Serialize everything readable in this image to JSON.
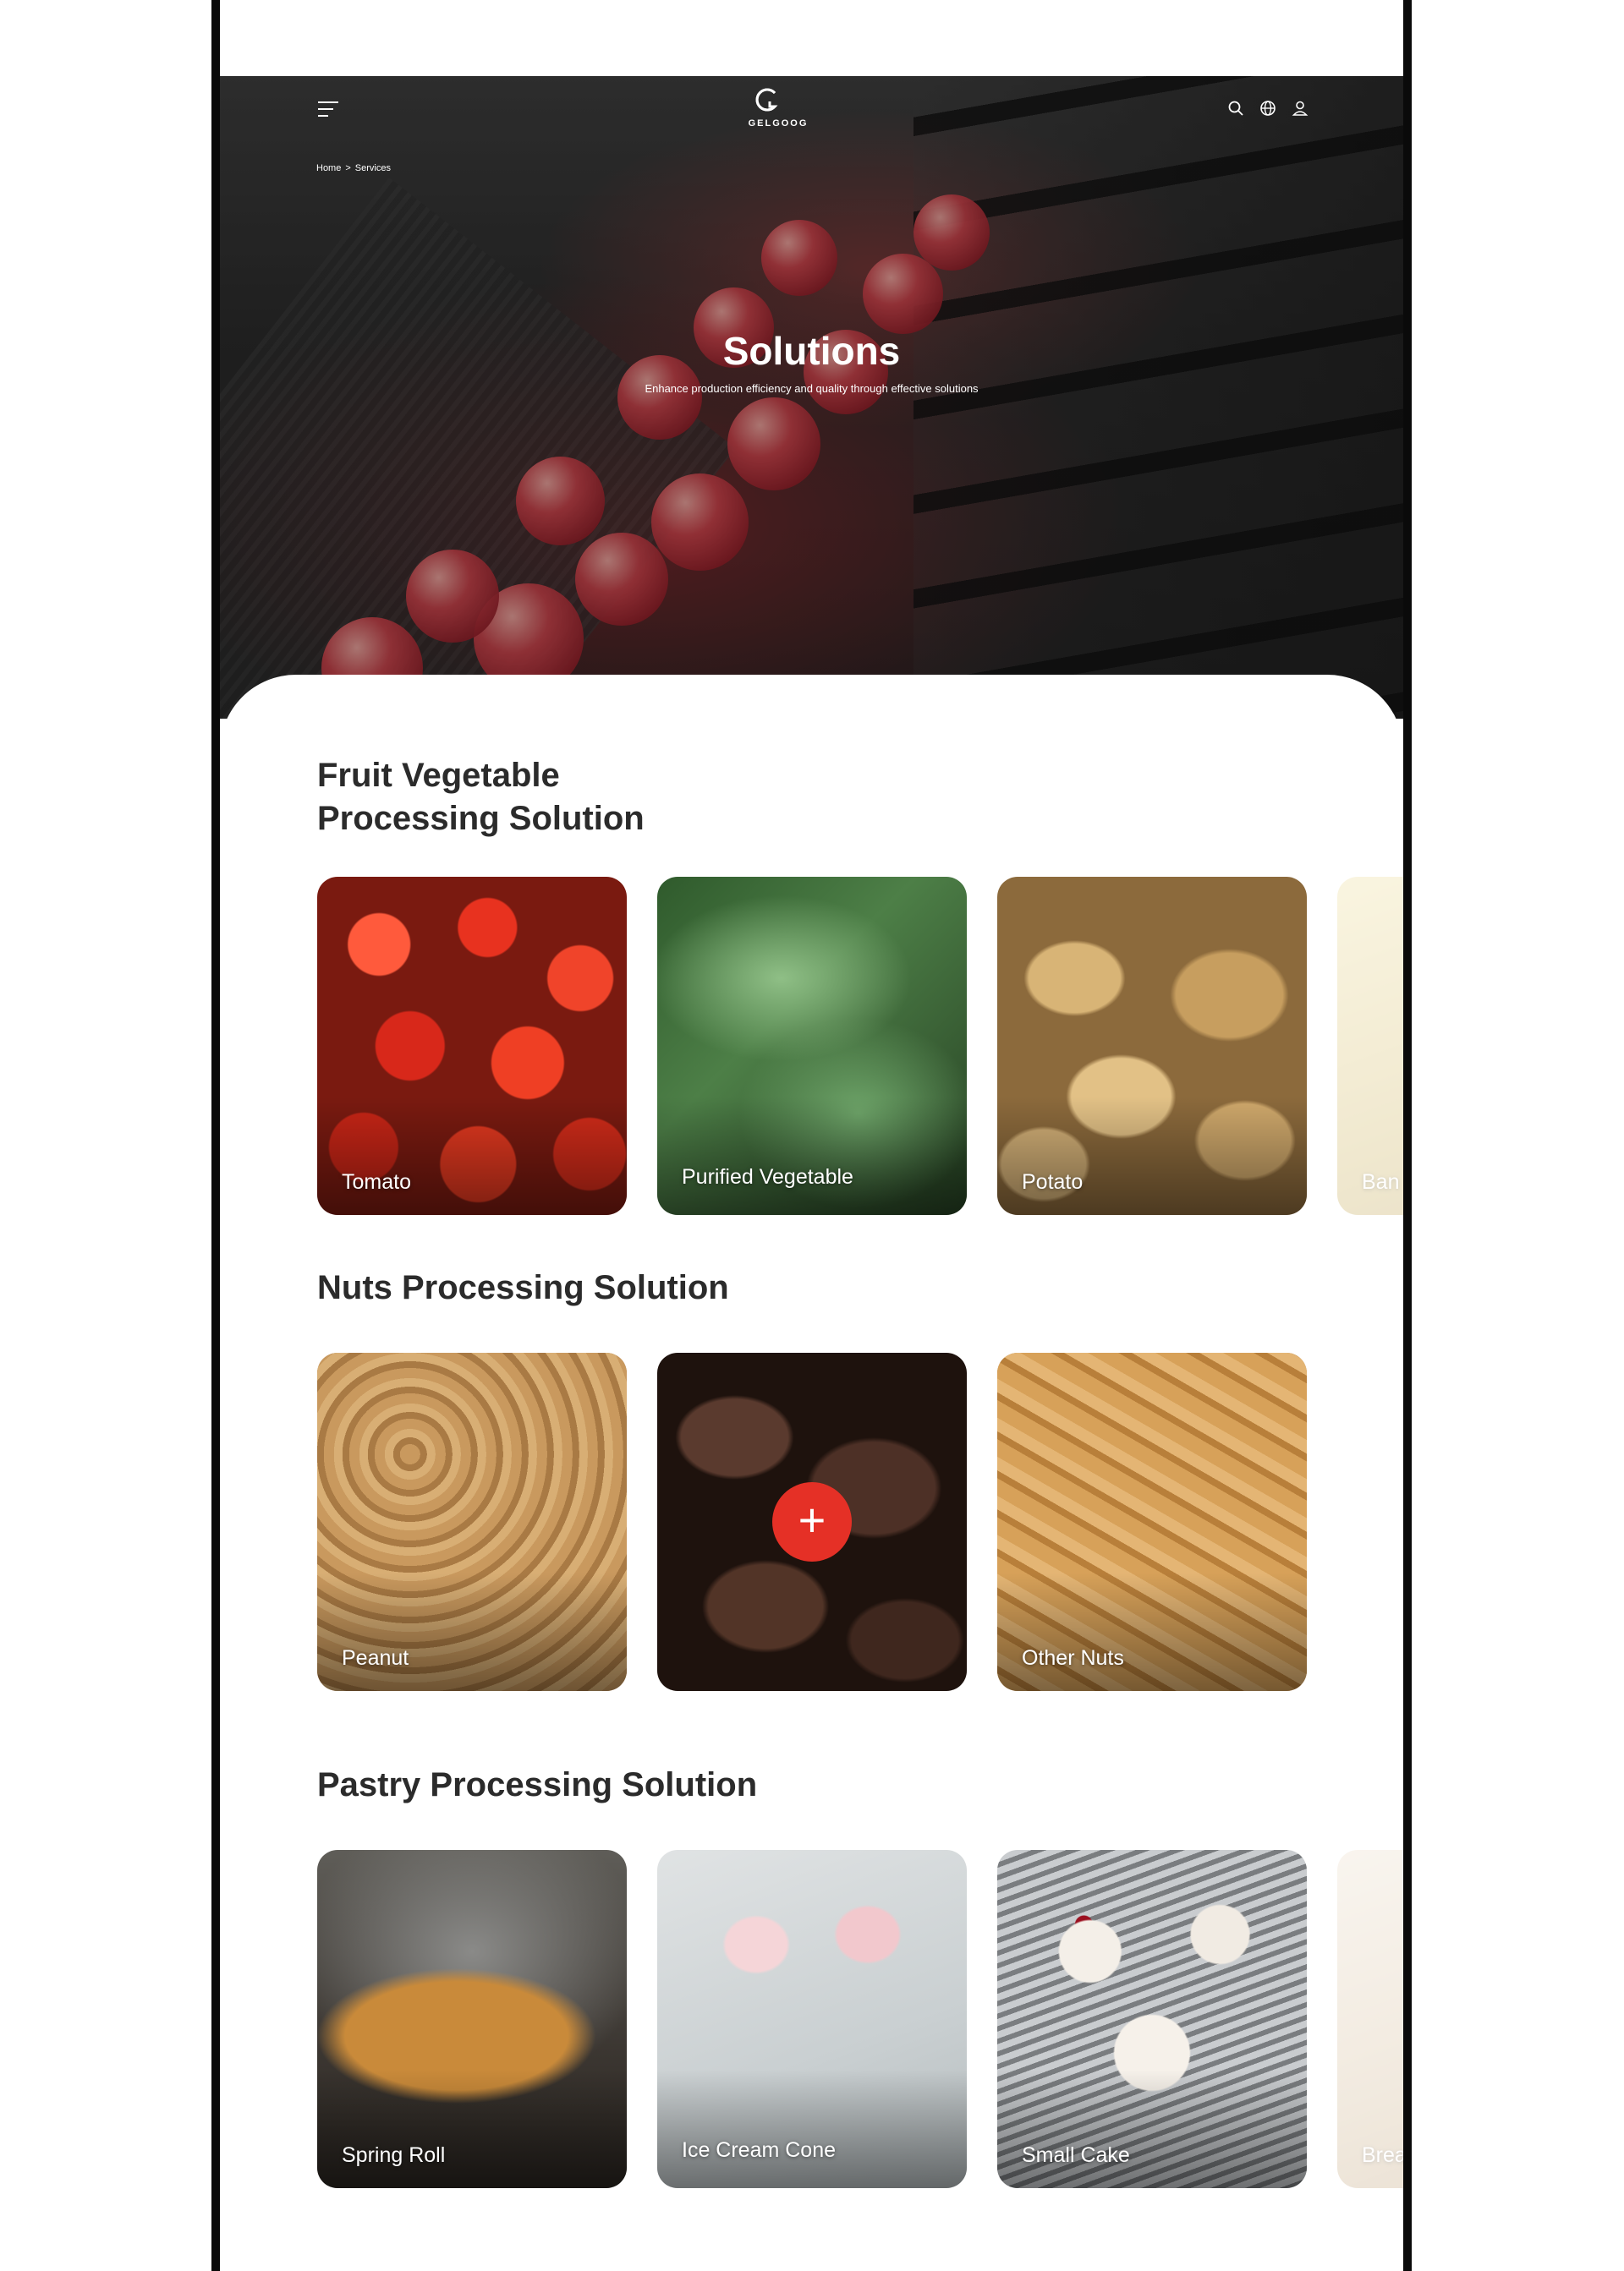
{
  "header": {
    "brand": "GELGOOG",
    "menu_icon": "menu-icon",
    "icons": [
      "search-icon",
      "globe-icon",
      "user-icon"
    ]
  },
  "breadcrumb": {
    "home": "Home",
    "separator": ">",
    "current": "Services"
  },
  "hero": {
    "title": "Solutions",
    "subtitle": "Enhance production efficiency and quality through effective solutions"
  },
  "sections": [
    {
      "title_line1": "Fruit Vegetable",
      "title_line2": "Processing Solution",
      "prev_label": "‹",
      "next_label": "›",
      "cards": [
        "Tomato",
        "Purified Vegetable",
        "Potato",
        "Ban"
      ]
    },
    {
      "title": "Nuts Processing Solution",
      "prev_label": "‹",
      "next_label": "›",
      "cards": [
        "Peanut",
        "",
        "Other Nuts"
      ],
      "plus_label": "+"
    },
    {
      "title": "Pastry Processing Solution",
      "prev_label": "‹",
      "next_label": "›",
      "cards": [
        "Spring Roll",
        "Ice Cream Cone",
        "Small Cake",
        "Brea"
      ]
    }
  ],
  "colors": {
    "accent": "#e53026",
    "heading": "#2b2b2b",
    "frame": "#0a0a0a"
  }
}
